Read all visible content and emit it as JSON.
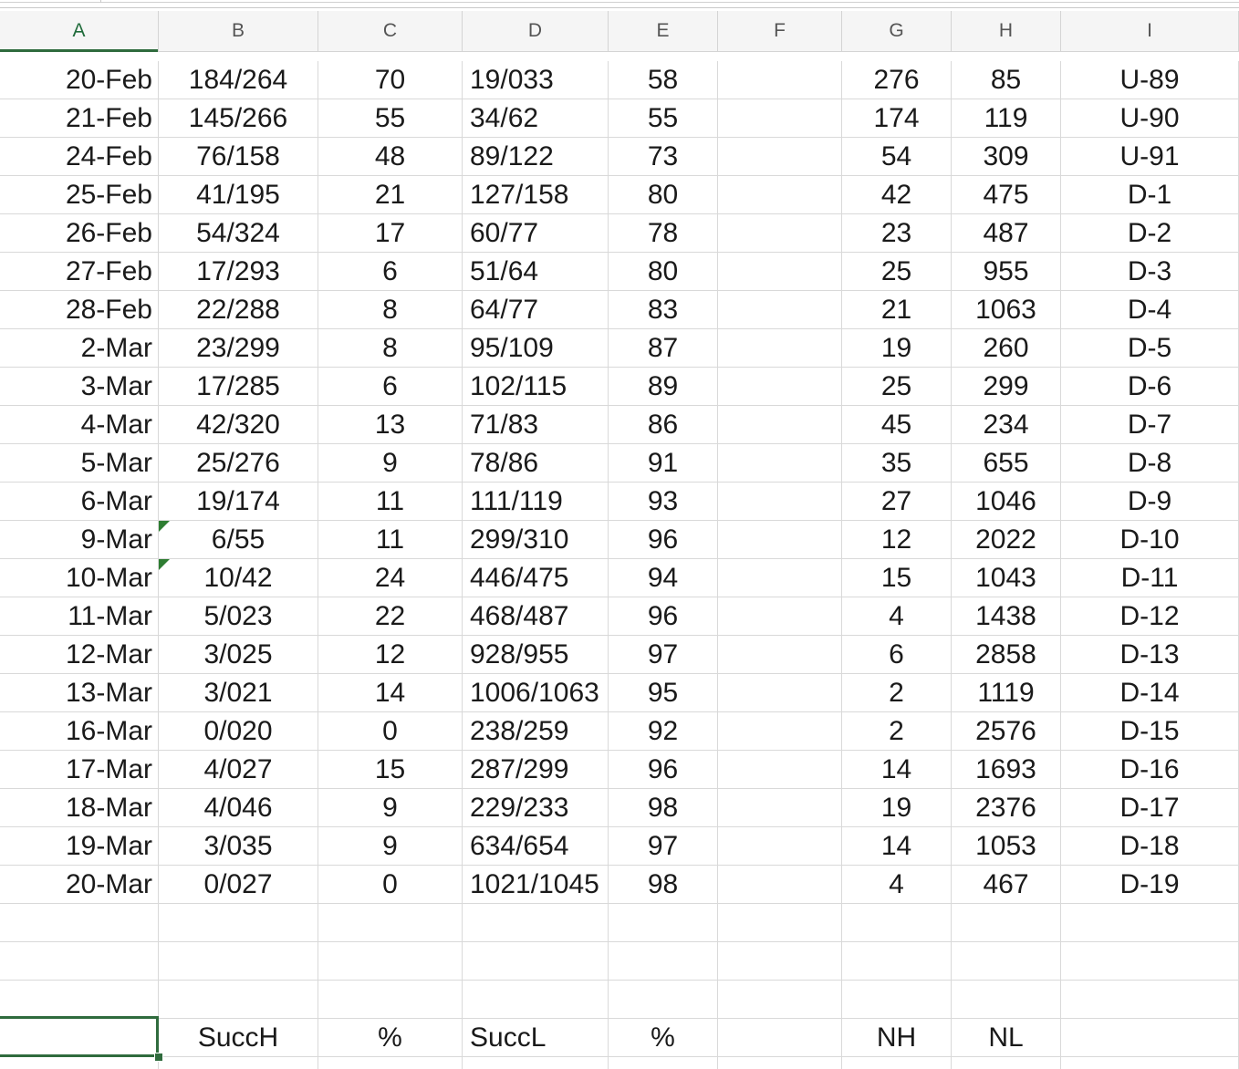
{
  "columns": [
    "A",
    "B",
    "C",
    "D",
    "E",
    "F",
    "G",
    "H",
    "I"
  ],
  "rows": [
    [
      "20-Feb",
      "184/264",
      "70",
      "19/033",
      "58",
      "",
      "276",
      "85",
      "U-89"
    ],
    [
      "21-Feb",
      "145/266",
      "55",
      "34/62",
      "55",
      "",
      "174",
      "119",
      "U-90"
    ],
    [
      "24-Feb",
      "76/158",
      "48",
      "89/122",
      "73",
      "",
      "54",
      "309",
      "U-91"
    ],
    [
      "25-Feb",
      "41/195",
      "21",
      "127/158",
      "80",
      "",
      "42",
      "475",
      "D-1"
    ],
    [
      "26-Feb",
      "54/324",
      "17",
      "60/77",
      "78",
      "",
      "23",
      "487",
      "D-2"
    ],
    [
      "27-Feb",
      "17/293",
      "6",
      "51/64",
      "80",
      "",
      "25",
      "955",
      "D-3"
    ],
    [
      "28-Feb",
      "22/288",
      "8",
      "64/77",
      "83",
      "",
      "21",
      "1063",
      "D-4"
    ],
    [
      "2-Mar",
      "23/299",
      "8",
      "95/109",
      "87",
      "",
      "19",
      "260",
      "D-5"
    ],
    [
      "3-Mar",
      "17/285",
      "6",
      "102/115",
      "89",
      "",
      "25",
      "299",
      "D-6"
    ],
    [
      "4-Mar",
      "42/320",
      "13",
      "71/83",
      "86",
      "",
      "45",
      "234",
      "D-7"
    ],
    [
      "5-Mar",
      "25/276",
      "9",
      "78/86",
      "91",
      "",
      "35",
      "655",
      "D-8"
    ],
    [
      "6-Mar",
      "19/174",
      "11",
      "111/119",
      "93",
      "",
      "27",
      "1046",
      "D-9"
    ],
    [
      "9-Mar",
      "6/55",
      "11",
      "299/310",
      "96",
      "",
      "12",
      "2022",
      "D-10"
    ],
    [
      "10-Mar",
      "10/42",
      "24",
      "446/475",
      "94",
      "",
      "15",
      "1043",
      "D-11"
    ],
    [
      "11-Mar",
      "5/023",
      "22",
      "468/487",
      "96",
      "",
      "4",
      "1438",
      "D-12"
    ],
    [
      "12-Mar",
      "3/025",
      "12",
      "928/955",
      "97",
      "",
      "6",
      "2858",
      "D-13"
    ],
    [
      "13-Mar",
      "3/021",
      "14",
      "1006/1063",
      "95",
      "",
      "2",
      "1119",
      "D-14"
    ],
    [
      "16-Mar",
      "0/020",
      "0",
      "238/259",
      "92",
      "",
      "2",
      "2576",
      "D-15"
    ],
    [
      "17-Mar",
      "4/027",
      "15",
      "287/299",
      "96",
      "",
      "14",
      "1693",
      "D-16"
    ],
    [
      "18-Mar",
      "4/046",
      "9",
      "229/233",
      "98",
      "",
      "19",
      "2376",
      "D-17"
    ],
    [
      "19-Mar",
      "3/035",
      "9",
      "634/654",
      "97",
      "",
      "14",
      "1053",
      "D-18"
    ],
    [
      "20-Mar",
      "0/027",
      "0",
      "1021/1045",
      "98",
      "",
      "4",
      "467",
      "D-19"
    ],
    [
      "",
      "",
      "",
      "",
      "",
      "",
      "",
      "",
      ""
    ],
    [
      "",
      "",
      "",
      "",
      "",
      "",
      "",
      "",
      ""
    ],
    [
      "",
      "",
      "",
      "",
      "",
      "",
      "",
      "",
      ""
    ],
    [
      "",
      "SuccH",
      "%",
      "SuccL",
      "%",
      "",
      "NH",
      "NL",
      ""
    ],
    [
      "",
      "",
      "",
      "",
      "",
      "",
      "",
      "",
      ""
    ]
  ],
  "flagged_rows": [
    12,
    13
  ],
  "selected_column": "A",
  "colors": {
    "selection": "#2f6b3d",
    "flag": "#2e7d32",
    "gridline": "#d9d9d9",
    "header_bg": "#f5f5f5"
  }
}
